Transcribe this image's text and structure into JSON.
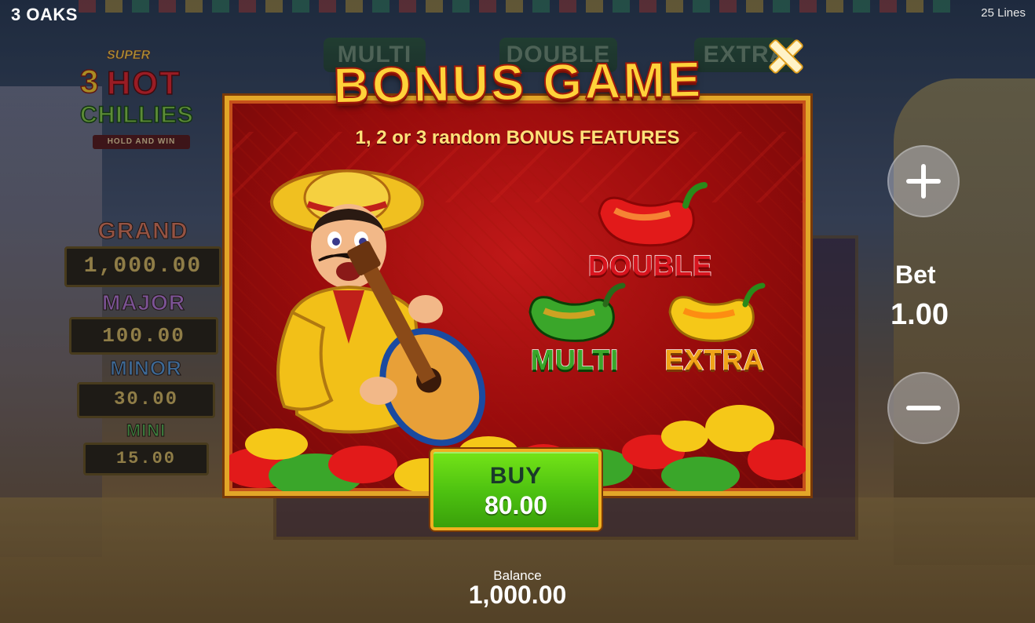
{
  "top_bar": {
    "brand": "3 OAKS",
    "lines": "25 Lines"
  },
  "logo": {
    "super": "SUPER",
    "number": "3",
    "hot": "HOT",
    "chillies": "CHILLIES",
    "subtitle": "HOLD AND WIN"
  },
  "reel_tabs": {
    "multi": "MULTI",
    "double": "DOUBLE",
    "extra": "EXTRA"
  },
  "jackpots": [
    {
      "label": "GRAND",
      "value": "1,000.00"
    },
    {
      "label": "MAJOR",
      "value": "100.00"
    },
    {
      "label": "MINOR",
      "value": "30.00"
    },
    {
      "label": "MINI",
      "value": "15.00"
    }
  ],
  "bet": {
    "label": "Bet",
    "value": "1.00"
  },
  "balance": {
    "label": "Balance",
    "value": "1,000.00"
  },
  "modal": {
    "title": "BONUS GAME",
    "subtitle": "1, 2 or 3 random BONUS FEATURES",
    "features": {
      "double": "DOUBLE",
      "multi": "MULTI",
      "extra": "EXTRA"
    },
    "buy_label": "BUY",
    "buy_price": "80.00"
  },
  "colors": {
    "modal_red": "#9a0c0c",
    "frame_gold": "#e2a628",
    "buy_green": "#4cc010",
    "double_red": "#d8141e",
    "multi_green": "#3aa62a",
    "extra_orange": "#f0a418"
  },
  "icons": {
    "close": "close-icon",
    "plus": "plus-icon",
    "minus": "minus-icon"
  }
}
